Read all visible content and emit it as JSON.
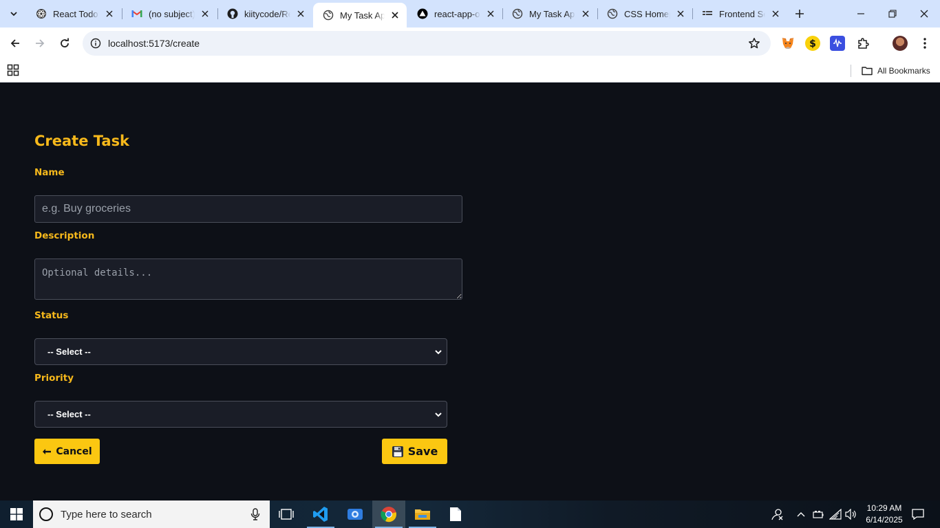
{
  "browser": {
    "tabs": [
      {
        "title": "React Todo App",
        "favicon": "react-icon",
        "active": false
      },
      {
        "title": "(no subject)",
        "favicon": "gmail-icon",
        "active": false
      },
      {
        "title": "kiitycode/React",
        "favicon": "github-icon",
        "active": false
      },
      {
        "title": "My Task App",
        "favicon": "globe-icon",
        "active": true
      },
      {
        "title": "react-app-ol",
        "favicon": "vercel-icon",
        "active": false
      },
      {
        "title": "My Task App",
        "favicon": "globe-icon",
        "active": false
      },
      {
        "title": "CSS Homepage",
        "favicon": "globe-icon",
        "active": false
      },
      {
        "title": "Frontend Se",
        "favicon": "list-icon",
        "active": false
      }
    ],
    "url": "localhost:5173/create",
    "bookmarks": {
      "all_label": "All Bookmarks"
    }
  },
  "form": {
    "title": "Create Task",
    "name": {
      "label": "Name",
      "placeholder": "e.g. Buy groceries",
      "value": ""
    },
    "description": {
      "label": "Description",
      "placeholder": "Optional details...",
      "value": ""
    },
    "status": {
      "label": "Status",
      "selected": "-- Select --"
    },
    "priority": {
      "label": "Priority",
      "selected": "-- Select --"
    },
    "cancel_label": "Cancel",
    "save_label": "Save"
  },
  "taskbar": {
    "search_placeholder": "Type here to search",
    "time": "10:29 AM",
    "date": "6/14/2025"
  },
  "colors": {
    "page_bg": "#0d1017",
    "accent": "#fbc711",
    "label": "#f7b91b",
    "field_bg": "#1a1d27"
  }
}
